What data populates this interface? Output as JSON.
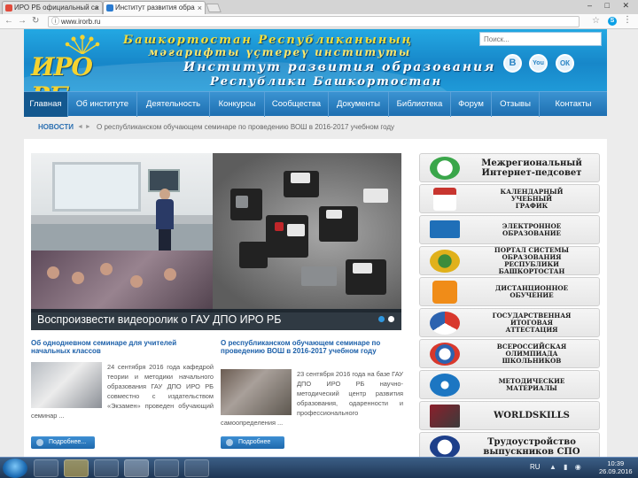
{
  "browser": {
    "tabs": [
      {
        "title": "ИРО РБ официальный са",
        "favicon_color": "#e14b3c"
      },
      {
        "title": "Институт развития обра",
        "favicon_color": "#2a7bd0"
      }
    ],
    "address": "www.irorb.ru",
    "window_controls": "– □ ✕"
  },
  "header": {
    "logo_text": "ИРО РБ",
    "title_lines": [
      "Башкортостан Республиканының",
      "мәғарифты үҫтереү институты",
      "Институт развития образования",
      "Республики Башкортостан"
    ],
    "search_placeholder": "Поиск...",
    "social": [
      "B",
      "You",
      "ОК"
    ]
  },
  "navigation": {
    "items": [
      "Главная",
      "Об институте",
      "Деятельность",
      "Конкурсы",
      "Сообщества",
      "Документы",
      "Библиотека",
      "Форум",
      "Отзывы",
      "Контакты"
    ],
    "active_index": 0
  },
  "ticker": {
    "label": "НОВОСТИ",
    "arrows": "◄ ►",
    "text": "О республиканском обучающем семинаре по проведению ВОШ в 2016-2017 учебном году"
  },
  "slider": {
    "caption": "Воспроизвести видеоролик о ГАУ ДПО ИРО РБ"
  },
  "news": [
    {
      "title": "Об однодневном семинаре для учителей начальных классов",
      "body": "24 сентября 2016 года кафедрой теории и методики начального образования ГАУ ДПО ИРО РБ совместно с издательством «Экзамен» проведен обучающий семинар ...",
      "more": "Подробнее..."
    },
    {
      "title": "О республиканском обучающем семинаре по проведению ВОШ в 2016-2017 учебном году",
      "body": "23 сентября 2016 года на базе ГАУ ДПО ИРО РБ научно-методический центр развития образования, одаренности и профессионального самоопределения ...",
      "more": "Подробнее"
    }
  ],
  "sidebar": [
    {
      "label": "Межрегиональный\nИнтернет-педсовет",
      "big": true,
      "icon_color": "#3aa64a"
    },
    {
      "label": "КАЛЕНДАРНЫЙ\nУЧЕБНЫЙ\nГРАФИК",
      "big": false,
      "icon_color": "#c8352f"
    },
    {
      "label": "ЭЛЕКТРОННОЕ\nОБРАЗОВАНИЕ",
      "big": false,
      "icon_color": "#1f6fb8"
    },
    {
      "label": "ПОРТАЛ СИСТЕМЫ\nОБРАЗОВАНИЯ\nРЕСПУБЛИКИ\nБАШКОРТОСТАН",
      "big": false,
      "icon_color": "#e0b11b"
    },
    {
      "label": "ДИСТАНЦИОННОЕ\nОБУЧЕНИЕ",
      "big": false,
      "icon_color": "#f08c18"
    },
    {
      "label": "ГОСУДАРСТВЕННАЯ\nИТОГОВАЯ\nАТТЕСТАЦИЯ",
      "big": false,
      "icon_color": "#d8382d"
    },
    {
      "label": "ВСЕРОССИЙСКАЯ\nОЛИМПИАДА\nШКОЛЬНИКОВ",
      "big": false,
      "icon_color": "#2c63b0"
    },
    {
      "label": "МЕТОДИЧЕСКИЕ\nМАТЕРИАЛЫ",
      "big": false,
      "icon_color": "#1c76c2"
    },
    {
      "label": "WORLDSKILLS",
      "big": false,
      "icon_color": "#8b1f2b"
    },
    {
      "label": "Трудоустройство\nвыпускников СПО",
      "big": true,
      "icon_color": "#1d3f8a"
    }
  ],
  "taskbar": {
    "lang": "RU",
    "time": "10:39",
    "date": "26.09.2016"
  }
}
